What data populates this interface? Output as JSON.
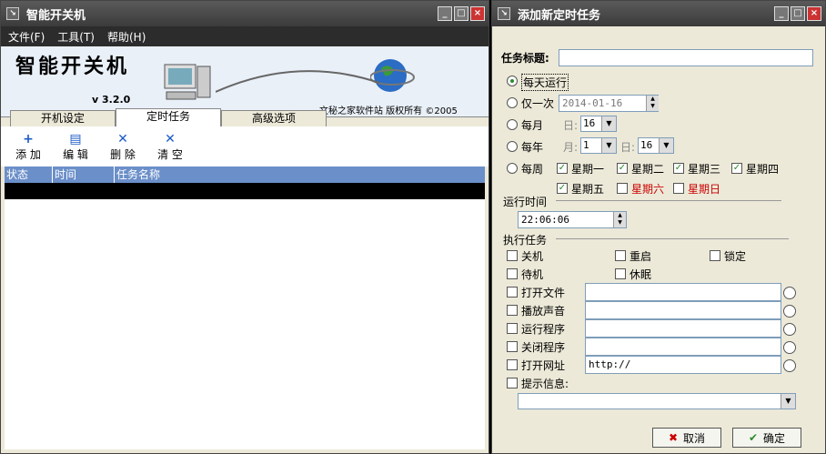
{
  "main": {
    "title": "智能开关机",
    "menu": [
      "文件(F)",
      "工具(T)",
      "帮助(H)"
    ],
    "logo_text": "智能开关机",
    "version": "v 3.2.0",
    "copyright": "文秘之家软件站 版权所有 ©2005",
    "tabs": [
      "开机设定",
      "定时任务",
      "高级选项"
    ],
    "active_tab": "定时任务",
    "toolbar": {
      "add": "添 加",
      "edit": "编 辑",
      "delete": "删 除",
      "clear": "清 空"
    },
    "columns": [
      "状态",
      "时间",
      "任务名称"
    ]
  },
  "dialog": {
    "title": "添加新定时任务",
    "task_title_label": "任务标题:",
    "task_title_value": "",
    "schedule": {
      "daily": "每天运行",
      "once": "仅一次",
      "once_date": "2014-01-16",
      "monthly": "每月",
      "day_label": "日:",
      "monthly_day": "16",
      "yearly": "每年",
      "month_label": "月:",
      "yearly_month": "1",
      "yearly_day": "16",
      "weekly": "每周",
      "weekdays": [
        "星期一",
        "星期二",
        "星期三",
        "星期四",
        "星期五",
        "星期六",
        "星期日"
      ],
      "selected": "daily"
    },
    "run_time_label": "运行时间",
    "run_time": "22:06:06",
    "exec_label": "执行任务",
    "actions": {
      "shutdown": "关机",
      "restart": "重启",
      "lock": "锁定",
      "standby": "待机",
      "hibernate": "休眠"
    },
    "file_rows": [
      "打开文件",
      "播放声音",
      "运行程序",
      "关闭程序",
      "打开网址"
    ],
    "url_value": "http://",
    "prompt_label": "提示信息:",
    "cancel": "取消",
    "ok": "确定"
  },
  "colors": {
    "accent": "#6b8fc9",
    "weekend": "#cc0000",
    "check": "#2a8b2a"
  }
}
